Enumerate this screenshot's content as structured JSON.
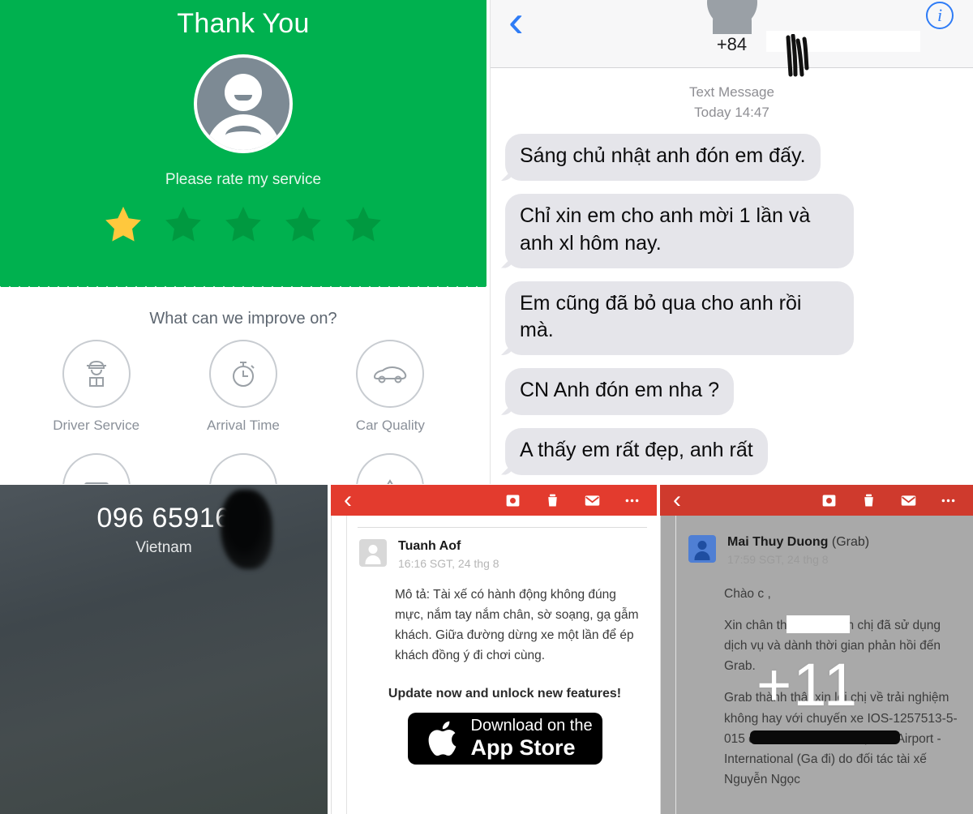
{
  "rating_panel": {
    "title": "Thank You",
    "subtitle": "Please rate my service",
    "avatar_icon": "sad-person-avatar-icon",
    "stars": {
      "total": 5,
      "selected": 1,
      "filled_color": "#FFC83D",
      "empty_color": "#009940"
    },
    "improve_question": "What can we improve on?",
    "categories": [
      {
        "label": "Driver Service",
        "icon": "driver-cap-icon"
      },
      {
        "label": "Arrival Time",
        "icon": "stopwatch-icon"
      },
      {
        "label": "Car Quality",
        "icon": "car-icon"
      }
    ],
    "categories_row2": [
      {
        "label": "",
        "icon": "ticket-icon"
      },
      {
        "label": "",
        "icon": "blank-icon"
      },
      {
        "label": "",
        "icon": "navigation-icon"
      }
    ],
    "brand_green": "#00B14F"
  },
  "sms_panel": {
    "back_icon": "chevron-left-icon",
    "info_icon": "info-circle-icon",
    "contact_avatar_icon": "person-avatar-icon",
    "contact_number": "+84",
    "service_type": "Text Message",
    "timestamp": "Today 14:47",
    "messages": [
      "Sáng chủ nhật anh đón em đấy.",
      "Chỉ xin em cho anh mời 1 lần và anh xl hôm nay.",
      "Em cũng đã bỏ qua cho anh rồi mà.",
      "CN Anh đón em nha ?",
      "A thấy em rất đẹp, anh rất"
    ],
    "bubble_color": "#E5E5EA",
    "accent_color": "#2F7CF6"
  },
  "call_panel": {
    "number": "096 65916",
    "country": "Vietnam"
  },
  "mail_mid": {
    "back_icon": "chevron-left-icon",
    "actions": [
      {
        "icon": "archive-box-icon"
      },
      {
        "icon": "trash-icon"
      },
      {
        "icon": "envelope-icon"
      },
      {
        "icon": "more-dots-icon"
      }
    ],
    "avatar_icon": "person-avatar-icon",
    "sender": "Tuanh Aof",
    "timestamp": "16:16 SGT, 24 thg 8",
    "body": [
      "Mô tả: Tài xế có hành động không đúng mực, nắm tay nắm chân, sờ soạng, gạ gẫm khách. Giữa đường dừng xe một lần để ép khách đồng ý đi chơi cùng."
    ],
    "promo": "Update now and unlock new features!",
    "appstore_small": "Download on the",
    "appstore_big": "App Store",
    "bar_color": "#E33B2E"
  },
  "mail_right": {
    "back_icon": "chevron-left-icon",
    "actions": [
      {
        "icon": "archive-box-icon"
      },
      {
        "icon": "trash-icon"
      },
      {
        "icon": "envelope-icon"
      },
      {
        "icon": "more-dots-icon"
      }
    ],
    "avatar_icon": "person-avatar-icon",
    "sender": "Mai Thuy Duong",
    "sender_org": "(Grab)",
    "timestamp": "17:59 SGT, 24 thg 8",
    "greeting": "Chào c",
    "greeting_tail": ",",
    "body": [
      "Xin chân thành cảm ơn chị đã sử dụng dịch vụ và dành thời gian phản hồi đến Grab.",
      "Grab thành thật xin lỗi chị về trải nghiệm không hay với chuyến xe IOS-1257513-5-015 đi từ Tòa Nhà    đến Nội Bài Airport - International (Ga đi) do đối tác tài xế Nguyễn Ngọc"
    ],
    "overlay_badge": "+11",
    "bar_color": "#CF3A2D"
  }
}
